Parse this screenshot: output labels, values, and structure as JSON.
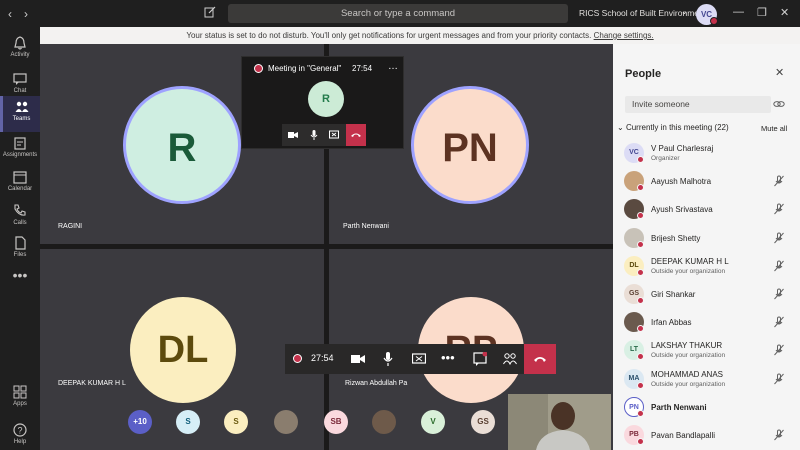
{
  "titlebar": {
    "search_placeholder": "Search or type a command",
    "org_name": "RICS School of Built Environment...",
    "user_initials": "VC"
  },
  "banner": {
    "text": "Your status is set to do not disturb. You'll only get notifications for urgent messages and from your priority contacts. ",
    "link": "Change settings."
  },
  "rail": {
    "items": [
      {
        "label": "Activity",
        "icon": "bell-icon"
      },
      {
        "label": "Chat",
        "icon": "chat-icon"
      },
      {
        "label": "Teams",
        "icon": "teams-icon",
        "active": true
      },
      {
        "label": "Assignments",
        "icon": "assignments-icon"
      },
      {
        "label": "Calendar",
        "icon": "calendar-icon"
      },
      {
        "label": "Calls",
        "icon": "phone-icon"
      },
      {
        "label": "Files",
        "icon": "files-icon"
      },
      {
        "label": "Apps",
        "icon": "apps-icon"
      },
      {
        "label": "Help",
        "icon": "help-icon"
      }
    ]
  },
  "tiles": [
    {
      "initials": "R",
      "name": "RAGINI",
      "bg": "#cfeee1",
      "fg": "#1a5a39"
    },
    {
      "initials": "PN",
      "name": "Parth Nenwani",
      "bg": "#fbdccb",
      "fg": "#5d3322"
    },
    {
      "initials": "DL",
      "name": "DEEPAK KUMAR H L",
      "bg": "#fbeec0",
      "fg": "#5c4a0d"
    },
    {
      "initials": "RP",
      "name": "Rizwan Abdullah Pa",
      "bg": "#fbdccb",
      "fg": "#5d3322"
    }
  ],
  "mini": {
    "title": "Meeting in \"General\"",
    "time": "27:54",
    "initials": "R"
  },
  "controls": {
    "time": "27:54"
  },
  "roster": [
    {
      "label": "+10",
      "bg": "#5b5fc7",
      "fg": "#ffffff"
    },
    {
      "label": "S",
      "bg": "#d6eef7",
      "fg": "#0f5d7a"
    },
    {
      "label": "S",
      "bg": "#fbeec0",
      "fg": "#6b5a0f"
    },
    {
      "label": "",
      "bg": "#8a7d6e",
      "fg": "#ffffff"
    },
    {
      "label": "SB",
      "bg": "#fad9de",
      "fg": "#7b2a3a"
    },
    {
      "label": "",
      "bg": "#6e5a4a",
      "fg": "#ffffff"
    },
    {
      "label": "V",
      "bg": "#d9f0d9",
      "fg": "#2a6b2a"
    },
    {
      "label": "GS",
      "bg": "#eaded6",
      "fg": "#5a4032"
    }
  ],
  "people": {
    "title": "People",
    "invite_placeholder": "Invite someone",
    "section_label": "Currently in this meeting (22)",
    "mute_all": "Mute all",
    "list": [
      {
        "name": "V Paul Charlesraj",
        "sub": "Organizer",
        "initials": "VC",
        "bg": "#dcdcf5",
        "fg": "#444791",
        "mic": false,
        "bold": false
      },
      {
        "name": "Aayush Malhotra",
        "sub": "",
        "initials": "",
        "bg": "#c9a27a",
        "fg": "#fff",
        "mic": true,
        "bold": false
      },
      {
        "name": "Ayush Srivastava",
        "sub": "",
        "initials": "",
        "bg": "#5a4a40",
        "fg": "#fff",
        "mic": true,
        "bold": false
      },
      {
        "name": "Brijesh Shetty",
        "sub": "",
        "initials": "",
        "bg": "#c8c2b8",
        "fg": "#fff",
        "mic": true,
        "bold": false
      },
      {
        "name": "DEEPAK KUMAR H L",
        "sub": "Outside your organization",
        "initials": "DL",
        "bg": "#fbeec0",
        "fg": "#5c4a0d",
        "mic": true,
        "bold": false
      },
      {
        "name": "Giri Shankar",
        "sub": "",
        "initials": "GS",
        "bg": "#eaded6",
        "fg": "#5a4032",
        "mic": true,
        "bold": false
      },
      {
        "name": "Irfan Abbas",
        "sub": "",
        "initials": "",
        "bg": "#6a5a4e",
        "fg": "#fff",
        "mic": true,
        "bold": false
      },
      {
        "name": "LAKSHAY THAKUR",
        "sub": "Outside your organization",
        "initials": "LT",
        "bg": "#d9f0e4",
        "fg": "#2a6b4a",
        "mic": true,
        "bold": false
      },
      {
        "name": "MOHAMMAD ANAS",
        "sub": "Outside your organization",
        "initials": "MA",
        "bg": "#dbe8f2",
        "fg": "#2a4f6b",
        "mic": true,
        "bold": false
      },
      {
        "name": "Parth Nenwani",
        "sub": "",
        "initials": "PN",
        "bg": "#ffffff",
        "fg": "#5b5fc7",
        "mic": false,
        "bold": true
      },
      {
        "name": "Pavan Bandlapalli",
        "sub": "",
        "initials": "PB",
        "bg": "#fad9de",
        "fg": "#7b2a3a",
        "mic": true,
        "bold": false
      }
    ]
  },
  "colors": {
    "accent": "#6264a7",
    "hangup": "#c4314b",
    "dnd": "#c4314b"
  }
}
